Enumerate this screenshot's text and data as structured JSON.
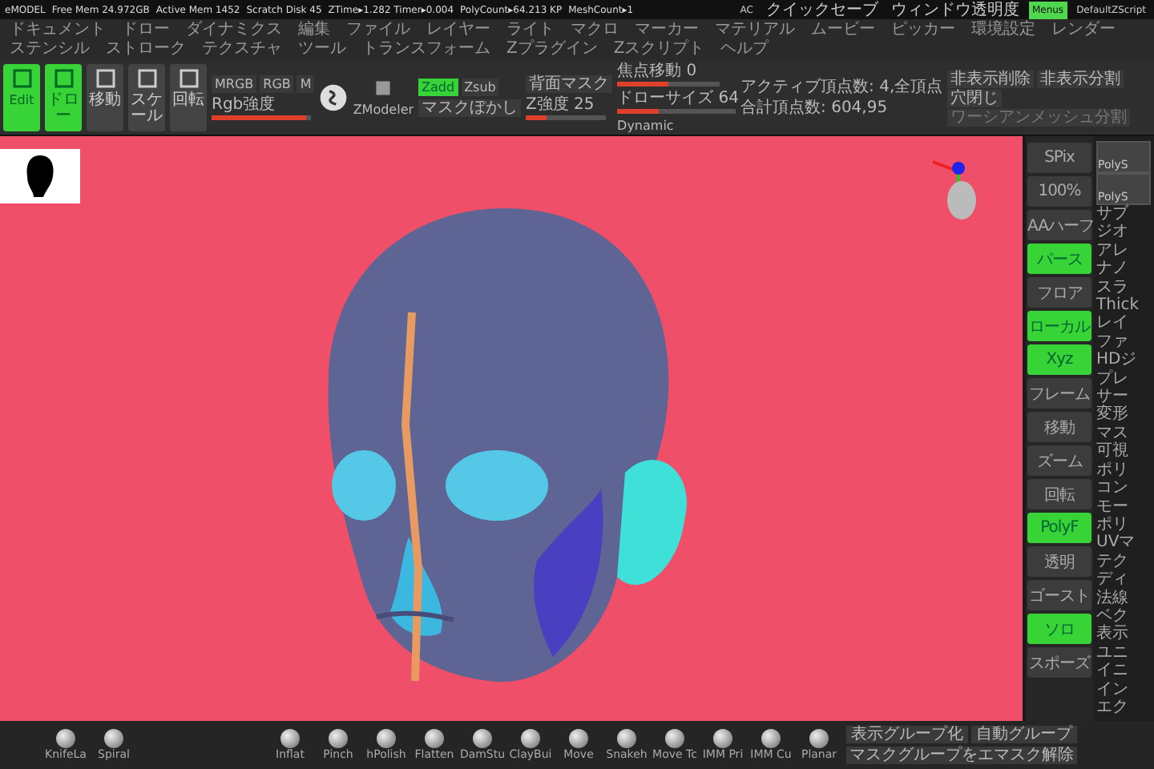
{
  "status_bar": {
    "items": [
      "eMODEL",
      "Free Mem 24.972GB",
      "Active Mem 1452",
      "Scratch Disk 45",
      "ZTime▸1.282 Timer▸0.004",
      "PolyCount▸64.213 KP",
      "MeshCount▸1"
    ],
    "right": [
      {
        "label": "AC",
        "selected": false
      },
      {
        "label": "クイックセーブ",
        "selected": false
      },
      {
        "label": "ウィンドウ透明度",
        "selected": false
      },
      {
        "label": "Menus",
        "selected": true
      },
      {
        "label": "DefaultZScript",
        "selected": false
      }
    ]
  },
  "menu": [
    "ドキュメント",
    "ドロー",
    "ダイナミクス",
    "編集",
    "ファイル",
    "レイヤー",
    "ライト",
    "マクロ",
    "マーカー",
    "マテリアル",
    "ムービー",
    "ピッカー",
    "環境設定",
    "レンダー",
    "ステンシル",
    "ストローク",
    "テクスチャ",
    "ツール",
    "トランスフォーム",
    "Zプラグイン",
    "Zスクリプト",
    "ヘルプ"
  ],
  "toolbar": {
    "modes": [
      {
        "label": "Edit",
        "on": true
      },
      {
        "label": "ドロー",
        "on": true
      },
      {
        "label": "移動",
        "on": false
      },
      {
        "label": "スケール",
        "on": false
      },
      {
        "label": "回転",
        "on": false
      }
    ],
    "channels": [
      {
        "label": "MRGB",
        "on": false
      },
      {
        "label": "RGB",
        "on": false
      },
      {
        "label": "M",
        "on": false
      }
    ],
    "rgb_intensity": {
      "label": "Rgb強度",
      "level": 0.95
    },
    "zmodeler": "ZModeler",
    "depth": [
      {
        "label": "Zadd",
        "on": true
      },
      {
        "label": "Zsub",
        "on": false
      }
    ],
    "mask_blur": "マスクぼかし",
    "z_intensity": {
      "label": "Z強度 25",
      "level": 0.25
    },
    "backface_mask": "背面マスク",
    "focal_shift": {
      "label": "焦点移動 0",
      "level": 0.5
    },
    "draw_size": {
      "label": "ドローサイズ 64",
      "level": 0.35
    },
    "dynamic": "Dynamic",
    "active_points": "アクティブ頂点数: 4,全頂点",
    "total_points": "合計頂点数: 604,95",
    "actions": [
      {
        "label": "非表示削除",
        "disabled": false
      },
      {
        "label": "非表示分割",
        "disabled": false
      },
      {
        "label": "穴閉じ",
        "disabled": false
      },
      {
        "label": "ワーシアンメッシュ分割",
        "disabled": true
      }
    ]
  },
  "shelf": [
    {
      "label": "SPix",
      "on": false
    },
    {
      "label": "100%",
      "on": false
    },
    {
      "label": "AAハーフ",
      "on": false
    },
    {
      "label": "パース",
      "on": true
    },
    {
      "label": "フロア",
      "on": false
    },
    {
      "label": "ローカル",
      "on": true
    },
    {
      "label": "Xyz",
      "on": true
    },
    {
      "label": "フレーム",
      "on": false
    },
    {
      "label": "移動",
      "on": false
    },
    {
      "label": "ズーム",
      "on": false
    },
    {
      "label": "回転",
      "on": false
    },
    {
      "label": "PolyF",
      "on": true
    },
    {
      "label": "透明",
      "on": false
    },
    {
      "label": "ゴースト",
      "on": false
    },
    {
      "label": "ソロ",
      "on": true
    },
    {
      "label": "スポーズ",
      "on": false
    }
  ],
  "tool_panel": {
    "thumbnails": [
      "PolyS",
      "PolyS"
    ],
    "items": [
      "サブ",
      "ジオ",
      "アレ",
      "ナノ",
      "スラ",
      "Thick",
      "レイ",
      "ファ",
      "HDジ",
      "プレ",
      "サー",
      "変形",
      "マス",
      "可視",
      "ポリ",
      "コン",
      "モー",
      "ポリ",
      "UVマ",
      "テク",
      "ディ",
      "法線",
      "ベク",
      "表示",
      "ユニ",
      "イニ",
      "イン",
      "エク"
    ]
  },
  "brushes": [
    "KnifeLa",
    "Spiral",
    "Inflat",
    "Pinch",
    "hPolish",
    "Flatten",
    "DamStu",
    "ClayBui",
    "Move",
    "Snakeh",
    "Move Tc",
    "IMM Pri",
    "IMM Cu",
    "Planar"
  ],
  "group_buttons": [
    "表示グループ化",
    "自動グループ",
    "マスクグループをエマスク解除"
  ]
}
